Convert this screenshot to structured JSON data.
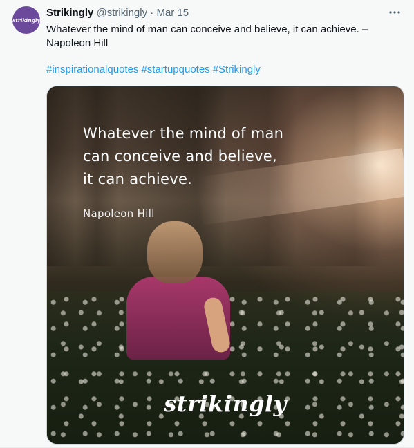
{
  "tweet": {
    "display_name": "Strikingly",
    "handle": "@strikingly",
    "separator": "·",
    "date": "Mar 15",
    "text_line1": "Whatever the mind of man can conceive and believe, it can achieve. –",
    "text_line2": "Napoleon Hill",
    "hashtags": [
      "#inspirationalquotes",
      "#startupquotes",
      "#Strikingly"
    ],
    "more_icon": "more-horizontal-icon"
  },
  "avatar": {
    "text": "strikingly",
    "color": "#6b4a9c"
  },
  "media": {
    "quote_line1": "Whatever the mind of man",
    "quote_line2": "can conceive and believe,",
    "quote_line3": "it can achieve.",
    "author": "Napoleon Hill",
    "logo": "strikingly"
  },
  "colors": {
    "hashtag": "#1d9bf0",
    "text": "#0f1419",
    "muted": "#536471"
  }
}
